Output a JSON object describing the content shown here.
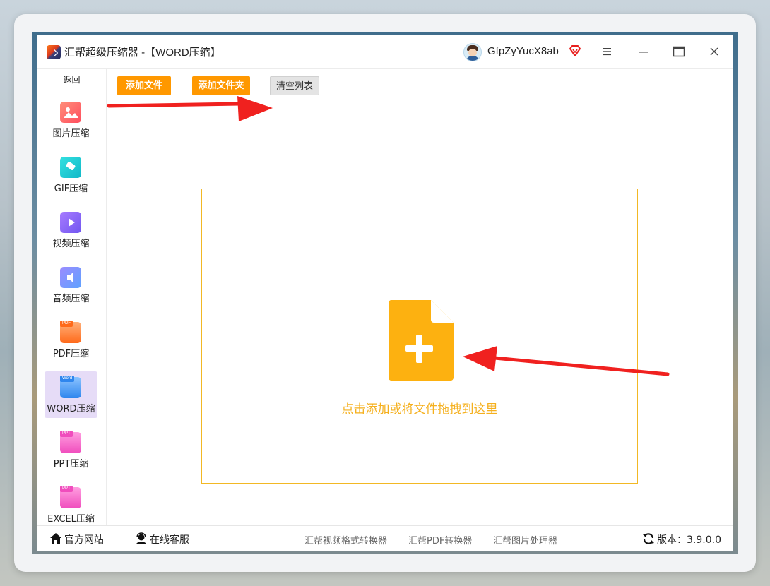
{
  "window": {
    "title": "汇帮超级压缩器  -【WORD压缩】",
    "user": {
      "name": "GfpZyYucX8ab"
    }
  },
  "icons": {
    "app": "app-logo-icon",
    "vip": "vip-diamond-icon",
    "menu": "hamburger-menu-icon",
    "minimize": "minimize-icon",
    "maximize": "maximize-icon",
    "close": "close-icon",
    "drop": "file-plus-icon",
    "home": "home-icon",
    "support": "customer-service-icon",
    "refresh": "refresh-icon"
  },
  "sidebar": {
    "back_label": "返回",
    "items": [
      {
        "label": "图片压缩",
        "icon": "image-icon",
        "color": "#ff6b6b"
      },
      {
        "label": "GIF压缩",
        "icon": "gif-icon",
        "color": "#1ecfd6"
      },
      {
        "label": "视频压缩",
        "icon": "video-icon",
        "color": "#8b6cf5"
      },
      {
        "label": "音频压缩",
        "icon": "audio-icon",
        "color": "#7b7cf0"
      },
      {
        "label": "PDF压缩",
        "icon": "pdf-icon",
        "color": "#ff7a2a",
        "tag": "PDF"
      },
      {
        "label": "WORD压缩",
        "icon": "word-icon",
        "color": "#3d8fef",
        "tag": "Word",
        "active": true
      },
      {
        "label": "PPT压缩",
        "icon": "ppt-icon",
        "color": "#f45fc5",
        "tag": "PPT"
      },
      {
        "label": "EXCEL压缩",
        "icon": "excel-icon",
        "color": "#f45fc5",
        "tag": "PPT"
      }
    ]
  },
  "toolbar": {
    "add_file": "添加文件",
    "add_folder": "添加文件夹",
    "clear_list": "清空列表"
  },
  "dropzone": {
    "hint": "点击添加或将文件拖拽到这里"
  },
  "footer": {
    "official_site": "官方网站",
    "online_support": "在线客服",
    "links": [
      "汇帮视频格式转换器",
      "汇帮PDF转换器",
      "汇帮图片处理器"
    ],
    "version": "版本：3.9.0.0"
  },
  "colors": {
    "accent_orange": "#ff9800",
    "drop_yellow": "#f5b01e",
    "active_bg": "#e6dcf7",
    "arrow_red": "#f0211f"
  }
}
